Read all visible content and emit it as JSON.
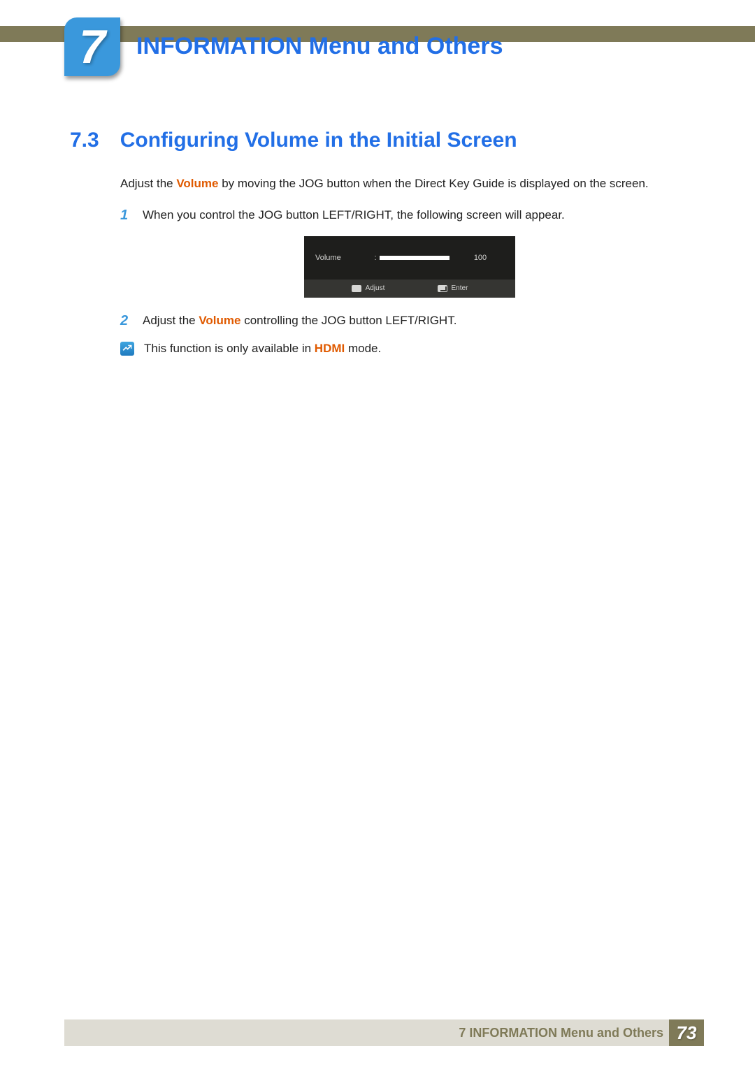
{
  "header": {
    "chapter_number": "7",
    "chapter_title": "INFORMATION Menu and Others"
  },
  "section": {
    "number": "7.3",
    "title": "Configuring Volume in the Initial Screen"
  },
  "intro": {
    "prefix": "Adjust the ",
    "bold1": "Volume",
    "suffix": " by moving the JOG button when the Direct Key Guide is displayed on the screen."
  },
  "steps": [
    {
      "num": "1",
      "text": "When you control the JOG button LEFT/RIGHT, the following screen will appear."
    },
    {
      "num": "2",
      "prefix": "Adjust the ",
      "bold": "Volume",
      "suffix": " controlling the JOG button LEFT/RIGHT."
    }
  ],
  "osd": {
    "label": "Volume",
    "value": "100",
    "adjust": "Adjust",
    "enter": "Enter"
  },
  "note": {
    "prefix": "This function is only available in ",
    "bold": "HDMI",
    "suffix": " mode."
  },
  "footer": {
    "text": "7 INFORMATION Menu and Others",
    "page": "73"
  }
}
